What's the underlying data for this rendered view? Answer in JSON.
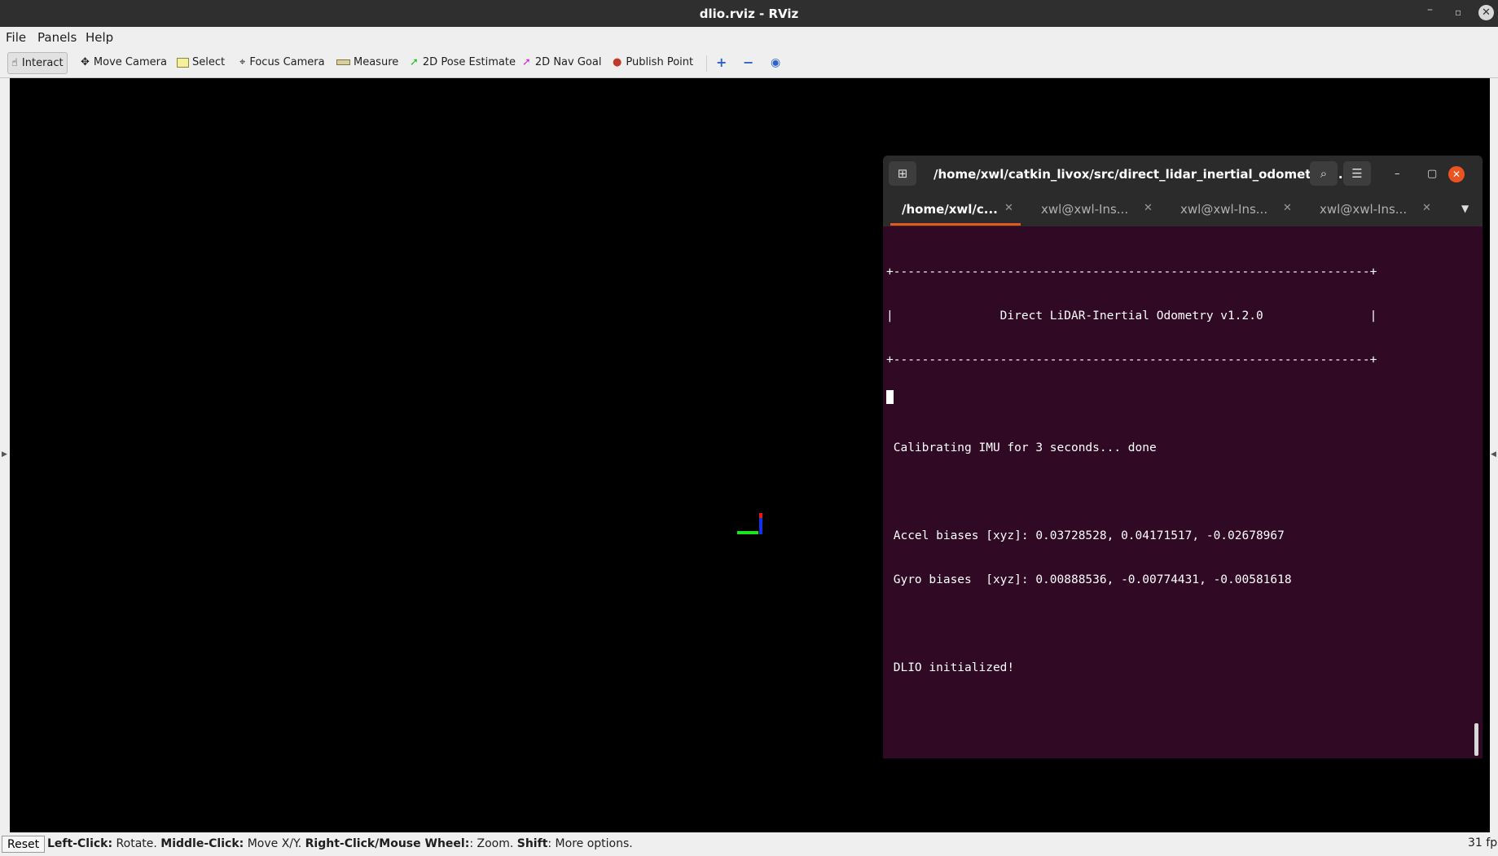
{
  "window": {
    "title": "dlio.rviz - RViz",
    "controls": {
      "minimize": "–",
      "maximize": "▫",
      "close": "✕"
    }
  },
  "menubar": {
    "items": [
      {
        "label": "File",
        "underline": "F"
      },
      {
        "label": "Panels",
        "underline": "P"
      },
      {
        "label": "Help",
        "underline": "H"
      }
    ]
  },
  "toolbar": {
    "tools": [
      {
        "id": "interact",
        "label": "Interact",
        "icon": "hand-icon",
        "active": true
      },
      {
        "id": "move-camera",
        "label": "Move Camera",
        "icon": "move-icon"
      },
      {
        "id": "select",
        "label": "Select",
        "icon": "select-box-icon"
      },
      {
        "id": "focus-camera",
        "label": "Focus Camera",
        "icon": "crosshair-icon"
      },
      {
        "id": "measure",
        "label": "Measure",
        "icon": "ruler-icon"
      },
      {
        "id": "2d-pose-estimate",
        "label": "2D Pose Estimate",
        "icon": "green-arrow-icon"
      },
      {
        "id": "2d-nav-goal",
        "label": "2D Nav Goal",
        "icon": "magenta-arrow-icon"
      },
      {
        "id": "publish-point",
        "label": "Publish Point",
        "icon": "map-pin-icon"
      }
    ],
    "extra_icons": [
      "plus-icon",
      "minus-icon",
      "eye-icon"
    ]
  },
  "statusbar": {
    "reset_label": "Reset",
    "hint": [
      {
        "key": "Left-Click:",
        "text": " Rotate. "
      },
      {
        "key": "Middle-Click:",
        "text": " Move X/Y. "
      },
      {
        "key": "Right-Click/Mouse Wheel:",
        "text": ": Zoom. "
      },
      {
        "key": "Shift",
        "text": ": More options."
      }
    ],
    "fps": "31 fp"
  },
  "terminal": {
    "title": "/home/xwl/catkin_livox/src/direct_lidar_inertial_odometry/l...",
    "tabs": [
      {
        "label": "/home/xwl/c...",
        "active": true
      },
      {
        "label": "xwl@xwl-Ins...",
        "active": false
      },
      {
        "label": "xwl@xwl-Ins...",
        "active": false
      },
      {
        "label": "xwl@xwl-Ins...",
        "active": false
      }
    ],
    "lines": [
      "+-------------------------------------------------------------------+",
      "|               Direct LiDAR-Inertial Odometry v1.2.0               |",
      "+-------------------------------------------------------------------+",
      "",
      " Calibrating IMU for 3 seconds... done",
      "",
      " Accel biases [xyz]: 0.03728528, 0.04171517, -0.02678967",
      " Gyro biases  [xyz]: 0.00888536, -0.00774431, -0.00581618",
      "",
      " DLIO initialized!"
    ]
  },
  "colors": {
    "terminal_bg": "#300a24",
    "accent": "#e95420",
    "axis_x": "#e8191e",
    "axis_y": "#19e61e",
    "axis_z": "#1432e6"
  }
}
